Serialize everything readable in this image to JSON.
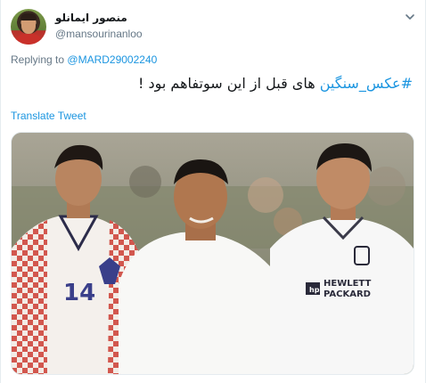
{
  "tweet": {
    "display_name": "منصور ایمانلو",
    "handle": "@mansourinanloo",
    "reply_prefix": "Replying to",
    "reply_to": "@MARD29002240",
    "hashtag": "#عکس_سنگین",
    "body": "های قبل از این سوتفاهم بود !",
    "translate_label": "Translate Tweet"
  },
  "photo": {
    "left_jersey_number": "14",
    "right_jersey_line1": "HEWLETT",
    "right_jersey_line2": "PACKARD",
    "right_jersey_logo": "hp"
  },
  "icons": {
    "menu_caret": "chevron-down-icon"
  },
  "colors": {
    "link": "#1b95e0",
    "secondary_text": "#657786",
    "primary_text": "#14171a",
    "border": "#e6ecf0"
  }
}
